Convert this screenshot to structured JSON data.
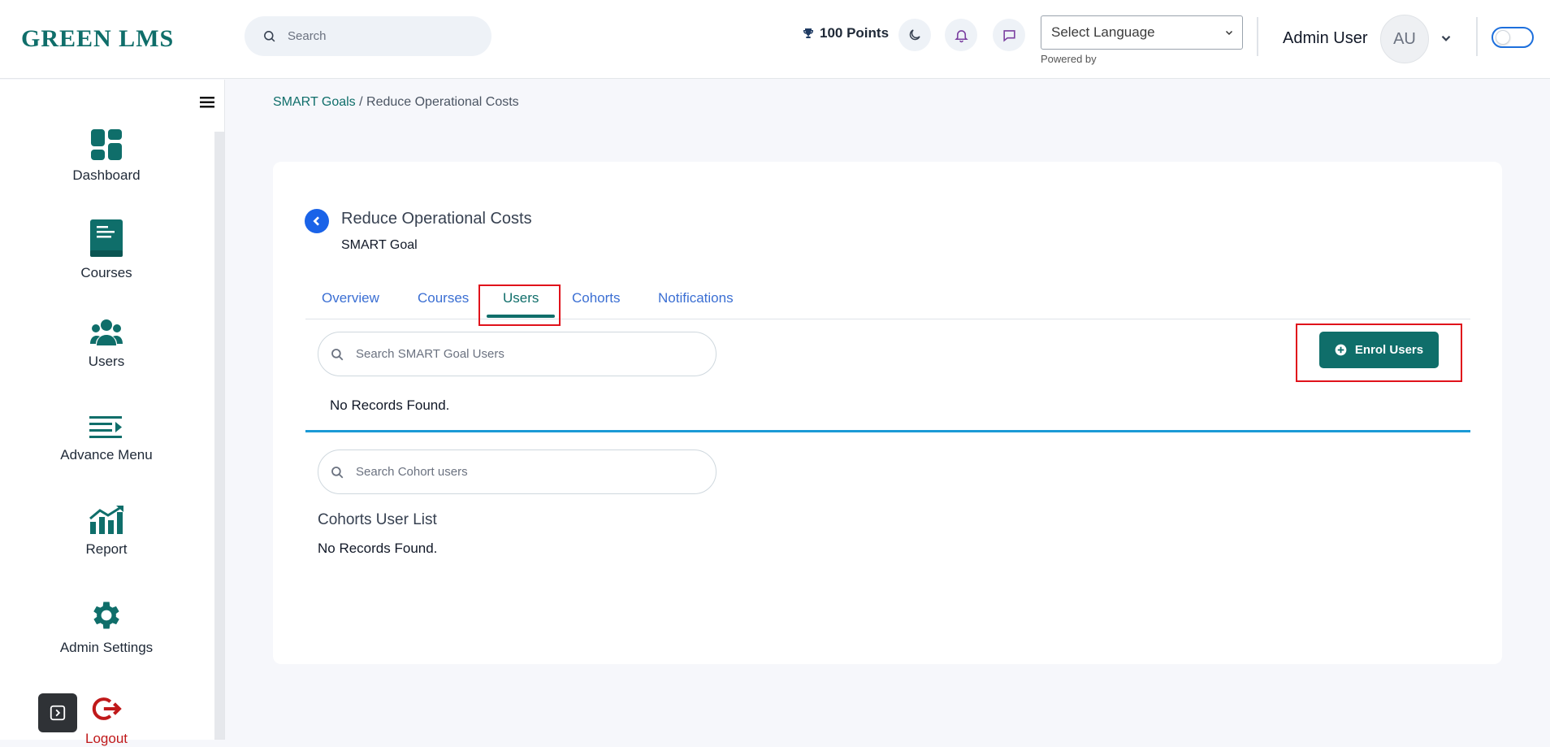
{
  "header": {
    "logo_text": "GREEN LMS",
    "search_placeholder": "Search",
    "points_label": "100 Points",
    "language_select": "Select Language",
    "powered_by": "Powered by",
    "user_name": "Admin User",
    "avatar_initials": "AU"
  },
  "sidebar": {
    "items": [
      {
        "label": "Dashboard",
        "icon": "dashboard-icon"
      },
      {
        "label": "Courses",
        "icon": "book-icon"
      },
      {
        "label": "Users",
        "icon": "users-icon"
      },
      {
        "label": "Advance Menu",
        "icon": "menu-list-icon"
      },
      {
        "label": "Report",
        "icon": "report-chart-icon"
      },
      {
        "label": "Admin Settings",
        "icon": "gear-icon"
      },
      {
        "label": "Logout",
        "icon": "logout-icon"
      }
    ]
  },
  "breadcrumb": {
    "parent": "SMART Goals",
    "separator": " / ",
    "current": "Reduce Operational Costs"
  },
  "goal": {
    "title": "Reduce Operational Costs",
    "subtitle": "SMART Goal"
  },
  "tabs": [
    {
      "label": "Overview"
    },
    {
      "label": "Courses"
    },
    {
      "label": "Users"
    },
    {
      "label": "Cohorts"
    },
    {
      "label": "Notifications"
    }
  ],
  "active_tab": "Users",
  "users_panel": {
    "search_placeholder": "Search SMART Goal Users",
    "enrol_button": "Enrol Users",
    "empty_text": "No Records Found."
  },
  "cohort_panel": {
    "search_placeholder": "Search Cohort users",
    "heading": "Cohorts User List",
    "empty_text": "No Records Found."
  },
  "colors": {
    "brand": "#0f6e6a",
    "tab_link": "#3b6fd3",
    "highlight": "#e0121b",
    "divider_blue": "#1a9ad6"
  }
}
